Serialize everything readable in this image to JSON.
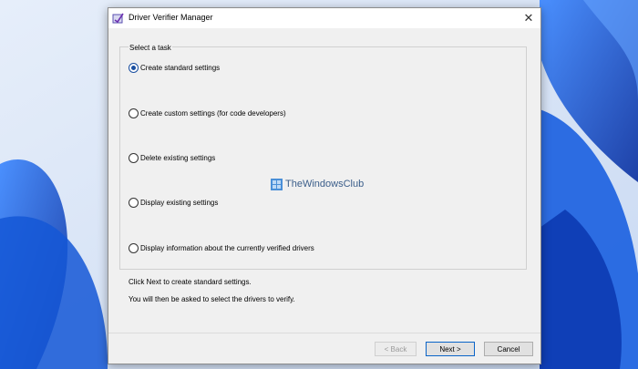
{
  "window": {
    "title": "Driver Verifier Manager",
    "close_glyph": "✕"
  },
  "group": {
    "label": "Select a task"
  },
  "options": [
    {
      "label": "Create standard settings",
      "checked": true
    },
    {
      "label": "Create custom settings (for code developers)",
      "checked": false
    },
    {
      "label": "Delete existing settings",
      "checked": false
    },
    {
      "label": "Display existing settings",
      "checked": false
    },
    {
      "label": "Display information about the currently verified drivers",
      "checked": false
    }
  ],
  "info": {
    "line1": "Click Next to create standard settings.",
    "line2": "You will then be asked to select the drivers to verify."
  },
  "watermark": {
    "text": "TheWindowsClub"
  },
  "buttons": {
    "back": "< Back",
    "next": "Next >",
    "cancel": "Cancel"
  },
  "colors": {
    "accent": "#1a4fa0",
    "wallpaper_blue": "#1f5fd6"
  }
}
